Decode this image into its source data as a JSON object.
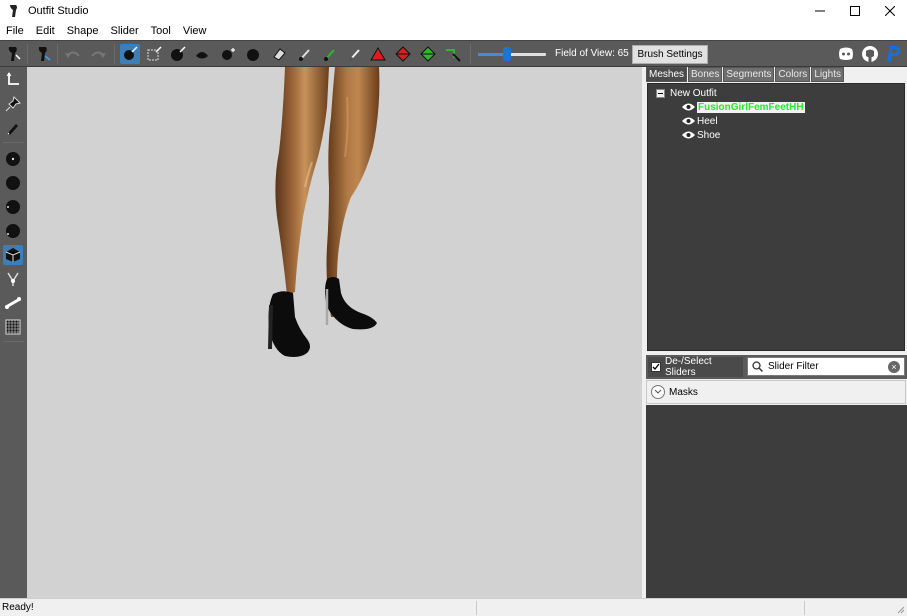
{
  "window": {
    "title": "Outfit Studio",
    "controls": [
      "minimize-icon",
      "maximize-icon",
      "close-icon"
    ]
  },
  "menu": [
    "File",
    "Edit",
    "Shape",
    "Slider",
    "Tool",
    "View"
  ],
  "toolbar": {
    "fov_label": "Field of View: 65",
    "fov_value": 65,
    "fov_slider_fraction": 0.42,
    "brush_settings_label": "Brush Settings",
    "icons": [
      "outfit-icon",
      "reference-icon",
      "undo-icon",
      "redo-icon",
      "select-brush-icon",
      "mask-brush-icon",
      "inflate-brush-icon",
      "deflate-brush-icon",
      "move-brush-icon",
      "smooth-brush-icon",
      "erase-brush-icon",
      "weight-brush-icon",
      "color-brush-icon",
      "alpha-brush-icon",
      "collapse-vertex-icon",
      "flip-edge-icon",
      "split-edge-icon",
      "transform-icon"
    ],
    "right_icons": [
      "discord-icon",
      "github-icon",
      "paypal-icon"
    ]
  },
  "left_tools": [
    "select-tool-icon",
    "pin-tool-icon",
    "pencil-tool-icon",
    "brush-small-icon",
    "brush-medium-icon",
    "brush-large-icon",
    "brush-xlarge-icon",
    "cube-view-icon",
    "bones-icon",
    "bone-connect-icon",
    "grid-icon"
  ],
  "tabs": [
    "Meshes",
    "Bones",
    "Segments",
    "Colors",
    "Lights"
  ],
  "active_tab": "Meshes",
  "tree": {
    "root": "New Outfit",
    "items": [
      {
        "label": "FusionGirlFemFeetHH",
        "selected": true
      },
      {
        "label": "Heel",
        "selected": false
      },
      {
        "label": "Shoe",
        "selected": false
      }
    ]
  },
  "sliders": {
    "deselect_label": "De-/Select Sliders",
    "deselect_checked": true,
    "filter_placeholder": "Slider Filter",
    "masks_label": "Masks"
  },
  "status": {
    "text": "Ready!"
  },
  "colors": {
    "toolbar_bg": "#5a5a5a",
    "accent": "#3c7fb8",
    "selected_mesh_text": "#2ee52e",
    "viewport_bg": "#d2d2d2"
  }
}
